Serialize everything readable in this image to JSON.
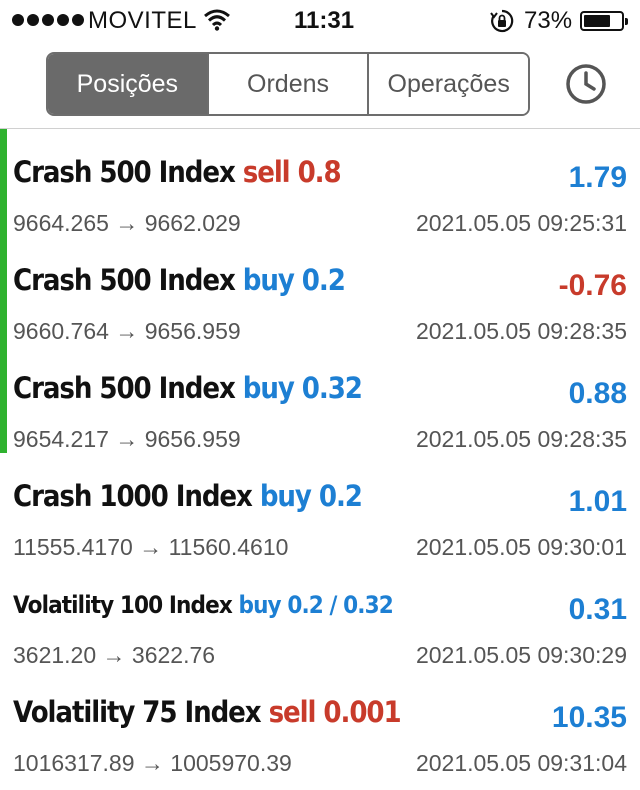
{
  "status_bar": {
    "carrier": "MOVITEL",
    "time": "11:31",
    "battery_percent": "73%",
    "battery_level": 0.73,
    "signal_bars": 5
  },
  "tabs": [
    {
      "label": "Posições",
      "active": true
    },
    {
      "label": "Ordens",
      "active": false
    },
    {
      "label": "Operações",
      "active": false
    }
  ],
  "history_icon": "clock-icon",
  "colors": {
    "sell": "#c83b2b",
    "buy": "#1d7fd3",
    "profit_positive": "#1d7fd3",
    "profit_negative": "#c83b2b",
    "open_marker": "#2fb22f",
    "active_tab": "#6a6a6a"
  },
  "trades": [
    {
      "symbol": "Crash 500 Index",
      "side": "sell",
      "volume": "0.8",
      "profit": "1.79",
      "open_price": "9664.265",
      "arrow": "→",
      "current_price": "9662.029",
      "time": "2021.05.05 09:25:31",
      "marked": true
    },
    {
      "symbol": "Crash 500 Index",
      "side": "buy",
      "volume": "0.2",
      "profit": "-0.76",
      "open_price": "9660.764",
      "arrow": "→",
      "current_price": "9656.959",
      "time": "2021.05.05 09:28:35",
      "marked": true
    },
    {
      "symbol": "Crash 500 Index",
      "side": "buy",
      "volume": "0.32",
      "profit": "0.88",
      "open_price": "9654.217",
      "arrow": "→",
      "current_price": "9656.959",
      "time": "2021.05.05 09:28:35",
      "marked": true
    },
    {
      "symbol": "Crash 1000 Index",
      "side": "buy",
      "volume": "0.2",
      "profit": "1.01",
      "open_price": "11555.4170",
      "arrow": "→",
      "current_price": "11560.4610",
      "time": "2021.05.05 09:30:01",
      "marked": false
    },
    {
      "symbol": "Volatility 100 Index",
      "side": "buy",
      "volume": "0.2 / 0.32",
      "profit": "0.31",
      "open_price": "3621.20",
      "arrow": "→",
      "current_price": "3622.76",
      "time": "2021.05.05 09:30:29",
      "marked": false
    },
    {
      "symbol": "Volatility 75 Index",
      "side": "sell",
      "volume": "0.001",
      "profit": "10.35",
      "open_price": "1016317.89",
      "arrow": "→",
      "current_price": "1005970.39",
      "time": "2021.05.05 09:31:04",
      "marked": false
    }
  ]
}
